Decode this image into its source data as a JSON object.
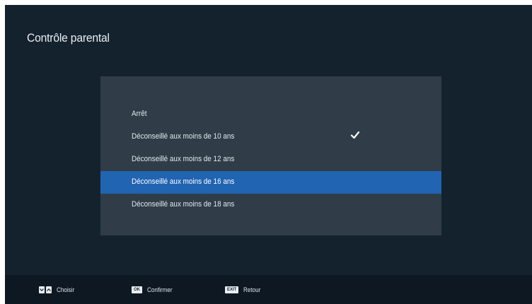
{
  "header": {
    "title": "Contrôle parental"
  },
  "menu": {
    "items": [
      {
        "label": "Arrêt"
      },
      {
        "label": "Déconseillé aux moins de 10 ans",
        "checked": true
      },
      {
        "label": "Déconseillé aux moins de 12 ans"
      },
      {
        "label": "Déconseillé aux moins de 16 ans",
        "highlighted": true
      },
      {
        "label": "Déconseillé aux moins de 18 ans"
      }
    ],
    "check_icon": "checkmark-icon"
  },
  "footer": {
    "choose": {
      "keys": [
        "arrow-down-icon",
        "arrow-up-icon"
      ],
      "label": "Choisir"
    },
    "confirm": {
      "key": "OK",
      "label": "Confirmer"
    },
    "back": {
      "key": "EXIT",
      "label": "Retour"
    }
  },
  "colors": {
    "background": "#14222e",
    "panel": "#303d49",
    "highlight": "#2064b2",
    "footer": "#0d1822",
    "text": "#e3e8ec"
  }
}
